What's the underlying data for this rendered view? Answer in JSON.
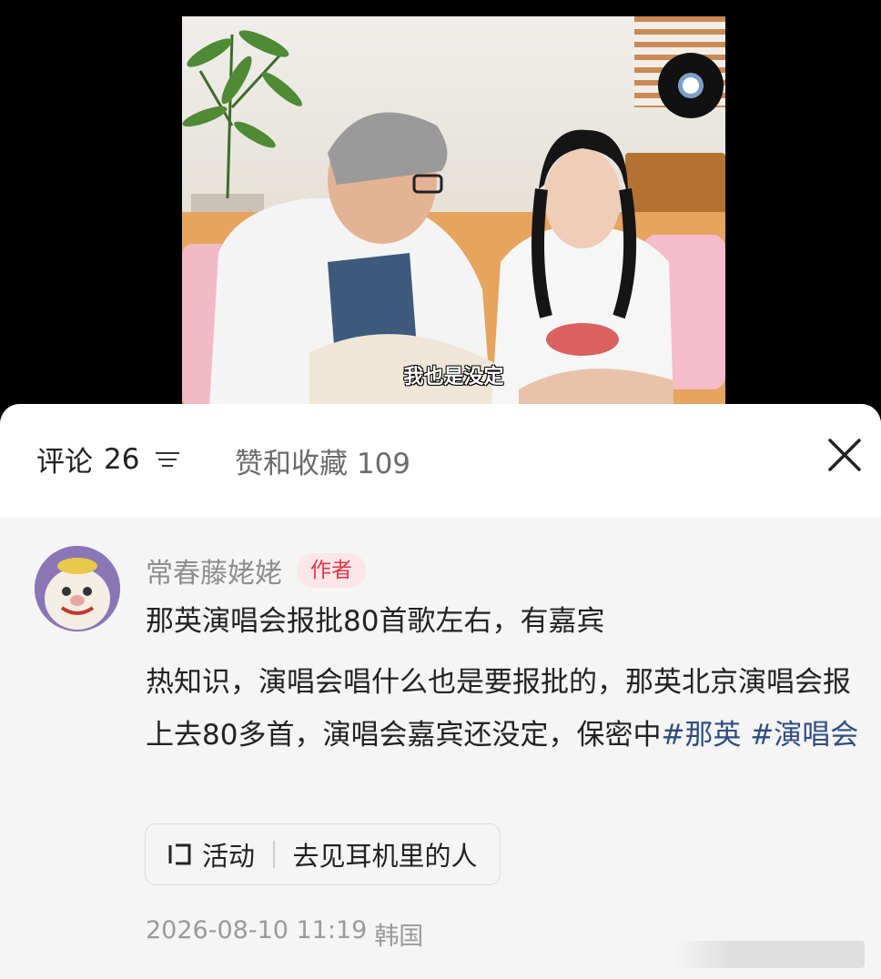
{
  "video": {
    "subtitle": "我也是没定"
  },
  "header": {
    "comments_label": "评论",
    "comments_count": "26",
    "likes_label": "赞和收藏",
    "likes_count": "109"
  },
  "comment": {
    "author_name": "常春藤姥姥",
    "author_tag": "作者",
    "title": "那英演唱会报批80首歌左右，有嘉宾",
    "body": "热知识，演唱会唱什么也是要报批的，那英北京演唱会报上去80多首，演唱会嘉宾还没定，保密中",
    "hashtags": [
      "#那英",
      "#演唱会"
    ],
    "activity_label": "活动",
    "activity_title": "去见耳机里的人",
    "date": "2026-08-10 11:19",
    "location": "韩国"
  },
  "icons": {
    "sort": "sort-lines-icon",
    "close": "close-icon",
    "activity": "activity-bracket-icon"
  }
}
